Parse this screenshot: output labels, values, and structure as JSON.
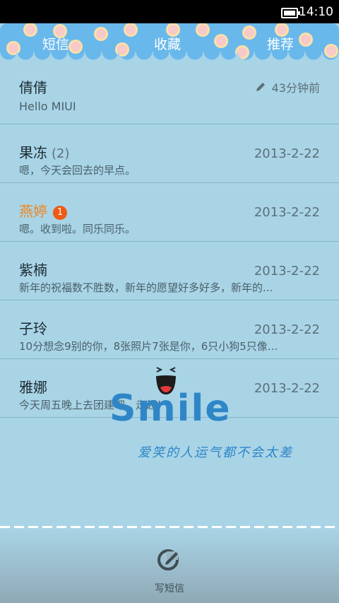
{
  "status_bar": {
    "time": "14:10"
  },
  "tabs": [
    "短信",
    "收藏",
    "推荐"
  ],
  "conversations": [
    {
      "name": "倩倩",
      "count": "",
      "badge": "",
      "preview": "Hello MIUI",
      "time": "43分钟前",
      "draft": true,
      "unread": false
    },
    {
      "name": "果冻",
      "count": "(2)",
      "badge": "",
      "preview": "嗯，今天会回去的早点。",
      "time": "2013-2-22",
      "draft": false,
      "unread": false
    },
    {
      "name": "燕婷",
      "count": "",
      "badge": "1",
      "preview": "嗯。收到啦。同乐同乐。",
      "time": "2013-2-22",
      "draft": false,
      "unread": true
    },
    {
      "name": "紫楠",
      "count": "",
      "badge": "",
      "preview": "新年的祝福数不胜数，新年的愿望好多好多，新年的...",
      "time": "2013-2-22",
      "draft": false,
      "unread": false
    },
    {
      "name": "子玲",
      "count": "",
      "badge": "",
      "preview": "10分想念9别的你，8张照片7张是你，6只小狗5只像...",
      "time": "2013-2-22",
      "draft": false,
      "unread": false
    },
    {
      "name": "雅娜",
      "count": "",
      "badge": "",
      "preview": "今天周五晚上去团建吧，走起！",
      "time": "2013-2-22",
      "draft": false,
      "unread": false
    }
  ],
  "wallpaper": {
    "title": "Smile",
    "tagline": "爱笑的人运气都不会太差"
  },
  "bottom": {
    "compose_label": "写短信"
  },
  "colors": {
    "tab_bg": "#69b8ec",
    "unread_name": "#f1851f",
    "badge": "#f05a13",
    "accent": "#2f86c7"
  }
}
